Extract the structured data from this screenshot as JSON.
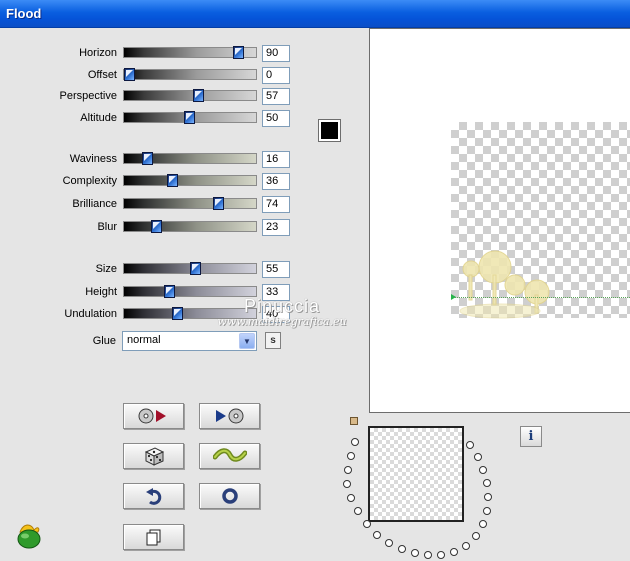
{
  "window": {
    "title": "Flood"
  },
  "colors": {
    "titlebar": "#0a5fe0",
    "panel": "#e5e5e5",
    "thumb": "#2d6fd0",
    "swatch": "#000000"
  },
  "group1": [
    {
      "label": "Horizon",
      "value": "90",
      "level": 90
    },
    {
      "label": "Offset",
      "value": "0",
      "level": 0
    },
    {
      "label": "Perspective",
      "value": "57",
      "level": 57
    },
    {
      "label": "Altitude",
      "value": "50",
      "level": 50
    }
  ],
  "group2": [
    {
      "label": "Waviness",
      "value": "16",
      "level": 16
    },
    {
      "label": "Complexity",
      "value": "36",
      "level": 36
    },
    {
      "label": "Brilliance",
      "value": "74",
      "level": 74
    },
    {
      "label": "Blur",
      "value": "23",
      "level": 23
    }
  ],
  "group3": [
    {
      "label": "Size",
      "value": "55",
      "level": 55
    },
    {
      "label": "Height",
      "value": "33",
      "level": 33
    },
    {
      "label": "Undulation",
      "value": "40",
      "level": 40
    }
  ],
  "watermark": {
    "name": "Pinuccia",
    "url": "www.maidiregrafica.eu"
  },
  "glue": {
    "label": "Glue",
    "selected": "normal",
    "s_button": "s"
  },
  "info": {
    "label": "i"
  },
  "icons": {
    "apply_left": "cd-arrow-icon",
    "apply_right": "arrow-cd-icon",
    "random": "dice-icon",
    "wave": "wave-icon",
    "undo": "undo-icon",
    "reset": "ring-icon",
    "copy": "copy-icon",
    "logo": "flaming-pear-logo-icon"
  }
}
